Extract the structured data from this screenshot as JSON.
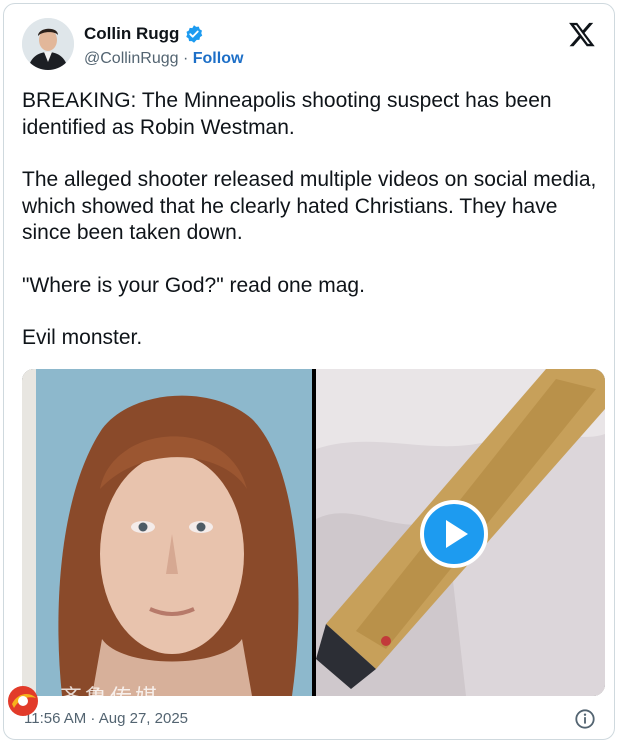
{
  "author": {
    "display_name": "Collin Rugg",
    "handle": "@CollinRugg",
    "separator": "·",
    "follow_label": "Follow",
    "verified_color": "#1d9bf0"
  },
  "platform_icon": "x-logo-icon",
  "tweet": {
    "paragraphs": [
      "BREAKING: The Minneapolis shooting suspect has been identified as Robin Westman.",
      "The alleged shooter released multiple videos on social media, which showed that he clearly hated Christians. They have since been taken down.",
      "\"Where is your God?\" read one mag.",
      "Evil monster."
    ]
  },
  "media": {
    "items": [
      {
        "kind": "photo",
        "icon": "portrait-photo"
      },
      {
        "kind": "video",
        "icon": "play-icon"
      }
    ]
  },
  "footer": {
    "timestamp": "11:56 AM · Aug 27, 2025",
    "info_icon": "info-icon"
  },
  "watermark": {
    "text": "齐鲁传媒"
  }
}
